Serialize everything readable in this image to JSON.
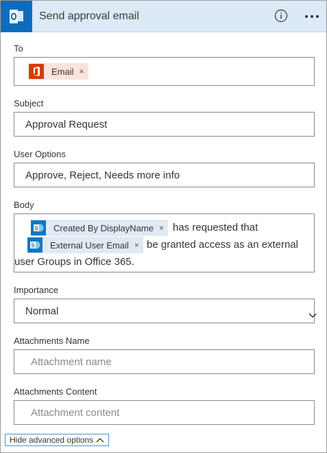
{
  "header": {
    "title": "Send approval email",
    "brand_color": "#0f6cbd"
  },
  "fields": {
    "to": {
      "label": "To",
      "token": {
        "label": "Email",
        "close": "×",
        "icon": "office-icon"
      }
    },
    "subject": {
      "label": "Subject",
      "value": "Approval Request"
    },
    "user_options": {
      "label": "User Options",
      "value": "Approve, Reject, Needs more info"
    },
    "body": {
      "label": "Body",
      "token1": {
        "label": "Created By DisplayName",
        "close": "×",
        "icon": "sharepoint-icon"
      },
      "text1": "has requested that",
      "token2": {
        "label": "External User Email",
        "close": "×",
        "icon": "sharepoint-icon"
      },
      "text2": "be granted access as an external",
      "text3": "user Groups in Office 365."
    },
    "importance": {
      "label": "Importance",
      "value": "Normal"
    },
    "attachments_name": {
      "label": "Attachments Name",
      "placeholder": "Attachment name"
    },
    "attachments_content": {
      "label": "Attachments Content",
      "placeholder": "Attachment content"
    }
  },
  "footer": {
    "toggle_label": "Hide advanced options"
  }
}
